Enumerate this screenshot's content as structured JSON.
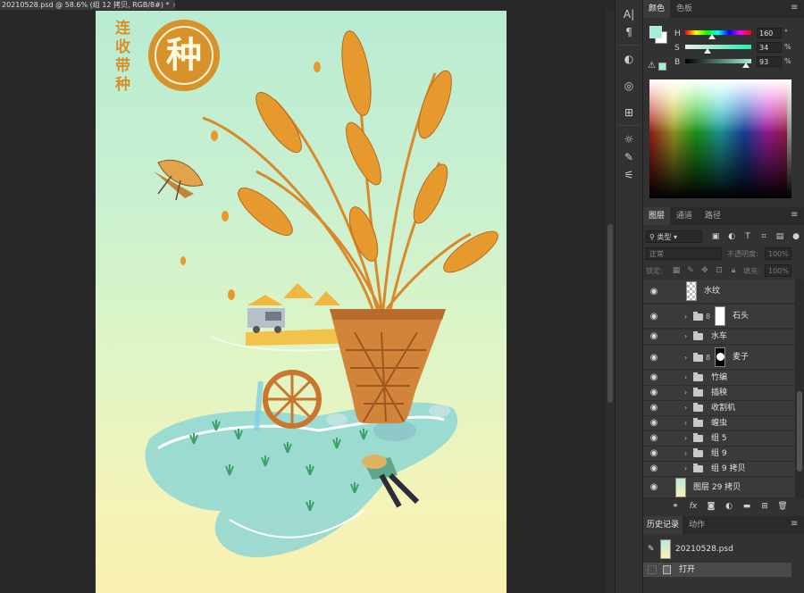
{
  "document_tab": {
    "title": "20210528.psd @ 58.6% (组 12 拷贝, RGB/8#) *",
    "close": "×"
  },
  "artwork": {
    "vertical_text": [
      "连",
      "收",
      "带",
      "种"
    ],
    "seal_char": "种",
    "colors": {
      "sky_top": "#b9ecd2",
      "sky_bottom": "#f9f1b0",
      "wheat": "#e69a2e",
      "basket": "#d2853a",
      "water": "#8ed6d4"
    }
  },
  "tools": [
    "A|",
    "¶",
    "◐",
    "◎",
    "⊞",
    "☼",
    "✎",
    "⚟"
  ],
  "color_panel": {
    "tabs": [
      "颜色",
      "色板"
    ],
    "foreground": "#a0eedc",
    "background": "#ffffff",
    "sliders": [
      {
        "label": "H",
        "value": "160",
        "unit": "°",
        "fraction": 0.44
      },
      {
        "label": "S",
        "value": "34",
        "unit": "%",
        "fraction": 0.34
      },
      {
        "label": "B",
        "value": "93",
        "unit": "%",
        "fraction": 0.93
      }
    ],
    "warning_icon": "triangle-warning"
  },
  "layers_panel": {
    "tabs": [
      "图层",
      "通道",
      "路径"
    ],
    "filter_label": "类型",
    "blend_mode": "正常",
    "opacity_label": "不透明度:",
    "opacity_value": "100%",
    "lock_label": "锁定:",
    "fill_label": "填充:",
    "fill_value": "100%",
    "layers": [
      {
        "name": "水纹",
        "type": "pixel"
      },
      {
        "name": "石头",
        "type": "group-mask"
      },
      {
        "name": "水车",
        "type": "group"
      },
      {
        "name": "麦子",
        "type": "group-mask"
      },
      {
        "name": "竹编",
        "type": "group"
      },
      {
        "name": "插秧",
        "type": "group"
      },
      {
        "name": "收割机",
        "type": "group"
      },
      {
        "name": "蝗虫",
        "type": "group"
      },
      {
        "name": "组 5",
        "type": "group"
      },
      {
        "name": "组 9",
        "type": "group"
      },
      {
        "name": "组 9 拷贝",
        "type": "group"
      },
      {
        "name": "图层 29 拷贝",
        "type": "pixel"
      }
    ],
    "footer_icons": [
      "link-icon",
      "fx-icon",
      "mask-icon",
      "adjustment-icon",
      "group-icon",
      "new-layer-icon",
      "trash-icon"
    ]
  },
  "history_panel": {
    "tabs": [
      "历史记录",
      "动作"
    ],
    "snapshot": "20210528.psd",
    "steps": [
      "打开"
    ]
  }
}
